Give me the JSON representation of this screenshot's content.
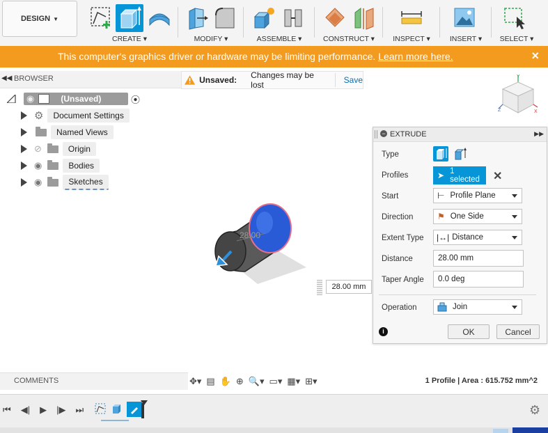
{
  "toolbar": {
    "workspace": "DESIGN",
    "groups": [
      {
        "label": "CREATE"
      },
      {
        "label": "MODIFY"
      },
      {
        "label": "ASSEMBLE"
      },
      {
        "label": "CONSTRUCT"
      },
      {
        "label": "INSPECT"
      },
      {
        "label": "INSERT"
      },
      {
        "label": "SELECT"
      }
    ]
  },
  "warning": {
    "message": "This computer's graphics driver or hardware may be limiting performance.",
    "link": "Learn more here.",
    "close": "×"
  },
  "browser": {
    "title": "BROWSER",
    "root": "(Unsaved)",
    "items": [
      {
        "label": "Document Settings"
      },
      {
        "label": "Named Views"
      },
      {
        "label": "Origin"
      },
      {
        "label": "Bodies"
      },
      {
        "label": "Sketches"
      }
    ]
  },
  "unsaved": {
    "label": "Unsaved:",
    "message": "Changes may be lost",
    "save": "Save"
  },
  "viewport": {
    "dimension_ghost": "28.00",
    "distance_input": "28.00 mm"
  },
  "extrude": {
    "title": "EXTRUDE",
    "labels": {
      "type": "Type",
      "profiles": "Profiles",
      "start": "Start",
      "direction": "Direction",
      "extent_type": "Extent Type",
      "distance": "Distance",
      "taper_angle": "Taper Angle",
      "operation": "Operation"
    },
    "values": {
      "profiles": "1 selected",
      "start": "Profile Plane",
      "direction": "One Side",
      "extent_type": "Distance",
      "distance": "28.00 mm",
      "taper_angle": "0.0 deg",
      "operation": "Join"
    },
    "ok": "OK",
    "cancel": "Cancel"
  },
  "comments": {
    "title": "COMMENTS"
  },
  "status": {
    "text": "1 Profile | Area : 615.752 mm^2"
  },
  "colors": {
    "accent": "#0696d7",
    "warning": "#f39b1f",
    "cylinder_face": "#2a5bd7"
  }
}
